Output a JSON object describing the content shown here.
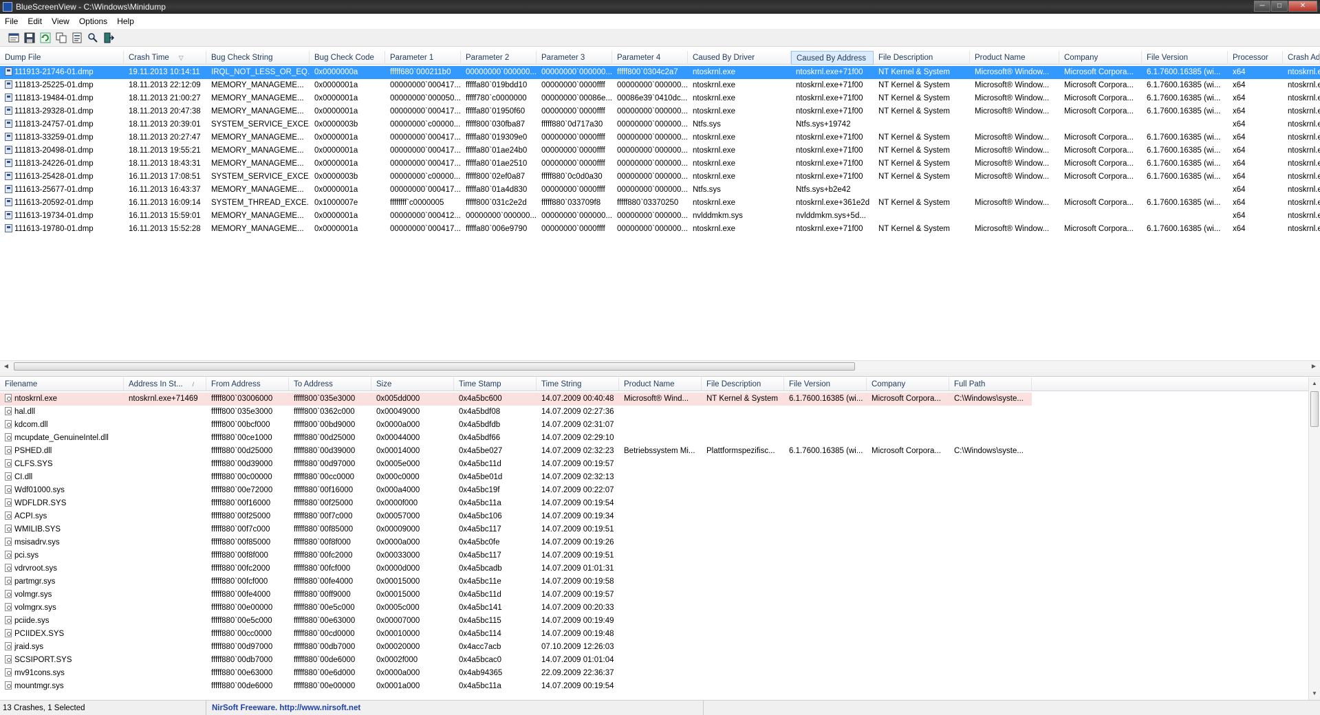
{
  "window": {
    "title": "BlueScreenView  -  C:\\Windows\\Minidump",
    "background_tabs": [
      "",
      "",
      "",
      "",
      ""
    ],
    "controls": [
      "─",
      "□",
      "✕"
    ]
  },
  "menu": [
    "File",
    "Edit",
    "View",
    "Options",
    "Help"
  ],
  "toolbar": [
    "properties-icon",
    "save-icon",
    "refresh-icon",
    "copy-icon",
    "html-report-icon",
    "find-icon",
    "exit-icon"
  ],
  "crashes": {
    "columns": [
      "Dump File",
      "Crash Time",
      "Bug Check String",
      "Bug Check Code",
      "Parameter 1",
      "Parameter 2",
      "Parameter 3",
      "Parameter 4",
      "Caused By Driver",
      "Caused By Address",
      "File Description",
      "Product Name",
      "Company",
      "File Version",
      "Processor",
      "Crash Add"
    ],
    "sort_indicator": "▽",
    "rows": [
      [
        "111913-21746-01.dmp",
        "19.11.2013 10:14:11",
        "IRQL_NOT_LESS_OR_EQ...",
        "0x0000000a",
        "fffff680`000211b0",
        "00000000`000000...",
        "00000000`000000...",
        "fffff800`0304c2a7",
        "ntoskrnl.exe",
        "ntoskrnl.exe+71f00",
        "NT Kernel & System",
        "Microsoft® Window...",
        "Microsoft Corpora...",
        "6.1.7600.16385 (wi...",
        "x64",
        "ntoskrnl.e"
      ],
      [
        "111813-25225-01.dmp",
        "18.11.2013 22:12:09",
        "MEMORY_MANAGEME...",
        "0x0000001a",
        "00000000`000417...",
        "fffffa80`019bdd10",
        "00000000`0000ffff",
        "00000000`000000...",
        "ntoskrnl.exe",
        "ntoskrnl.exe+71f00",
        "NT Kernel & System",
        "Microsoft® Window...",
        "Microsoft Corpora...",
        "6.1.7600.16385 (wi...",
        "x64",
        "ntoskrnl.e"
      ],
      [
        "111813-19484-01.dmp",
        "18.11.2013 21:00:27",
        "MEMORY_MANAGEME...",
        "0x0000001a",
        "00000000`000050...",
        "fffff780`c0000000",
        "00000000`00086e...",
        "00086e39`0410dc...",
        "ntoskrnl.exe",
        "ntoskrnl.exe+71f00",
        "NT Kernel & System",
        "Microsoft® Window...",
        "Microsoft Corpora...",
        "6.1.7600.16385 (wi...",
        "x64",
        "ntoskrnl.e"
      ],
      [
        "111813-29328-01.dmp",
        "18.11.2013 20:47:38",
        "MEMORY_MANAGEME...",
        "0x0000001a",
        "00000000`000417...",
        "fffffa80`01950f60",
        "00000000`0000ffff",
        "00000000`000000...",
        "ntoskrnl.exe",
        "ntoskrnl.exe+71f00",
        "NT Kernel & System",
        "Microsoft® Window...",
        "Microsoft Corpora...",
        "6.1.7600.16385 (wi...",
        "x64",
        "ntoskrnl.e"
      ],
      [
        "111813-24757-01.dmp",
        "18.11.2013 20:39:01",
        "SYSTEM_SERVICE_EXCE...",
        "0x0000003b",
        "00000000`c00000...",
        "fffff800`030fba87",
        "fffff880`0d717a30",
        "00000000`000000...",
        "Ntfs.sys",
        "Ntfs.sys+19742",
        "",
        "",
        "",
        "",
        "x64",
        "ntoskrnl.e"
      ],
      [
        "111813-33259-01.dmp",
        "18.11.2013 20:27:47",
        "MEMORY_MANAGEME...",
        "0x0000001a",
        "00000000`000417...",
        "fffffa80`019309e0",
        "00000000`0000ffff",
        "00000000`000000...",
        "ntoskrnl.exe",
        "ntoskrnl.exe+71f00",
        "NT Kernel & System",
        "Microsoft® Window...",
        "Microsoft Corpora...",
        "6.1.7600.16385 (wi...",
        "x64",
        "ntoskrnl.e"
      ],
      [
        "111813-20498-01.dmp",
        "18.11.2013 19:55:21",
        "MEMORY_MANAGEME...",
        "0x0000001a",
        "00000000`000417...",
        "fffffa80`01ae24b0",
        "00000000`0000ffff",
        "00000000`000000...",
        "ntoskrnl.exe",
        "ntoskrnl.exe+71f00",
        "NT Kernel & System",
        "Microsoft® Window...",
        "Microsoft Corpora...",
        "6.1.7600.16385 (wi...",
        "x64",
        "ntoskrnl.e"
      ],
      [
        "111813-24226-01.dmp",
        "18.11.2013 18:43:31",
        "MEMORY_MANAGEME...",
        "0x0000001a",
        "00000000`000417...",
        "fffffa80`01ae2510",
        "00000000`0000ffff",
        "00000000`000000...",
        "ntoskrnl.exe",
        "ntoskrnl.exe+71f00",
        "NT Kernel & System",
        "Microsoft® Window...",
        "Microsoft Corpora...",
        "6.1.7600.16385 (wi...",
        "x64",
        "ntoskrnl.e"
      ],
      [
        "111613-25428-01.dmp",
        "16.11.2013 17:08:51",
        "SYSTEM_SERVICE_EXCE...",
        "0x0000003b",
        "00000000`c00000...",
        "fffff800`02ef0a87",
        "fffff880`0c0d0a30",
        "00000000`000000...",
        "ntoskrnl.exe",
        "ntoskrnl.exe+71f00",
        "NT Kernel & System",
        "Microsoft® Window...",
        "Microsoft Corpora...",
        "6.1.7600.16385 (wi...",
        "x64",
        "ntoskrnl.e"
      ],
      [
        "111613-25677-01.dmp",
        "16.11.2013 16:43:37",
        "MEMORY_MANAGEME...",
        "0x0000001a",
        "00000000`000417...",
        "fffffa80`01a4d830",
        "00000000`0000ffff",
        "00000000`000000...",
        "Ntfs.sys",
        "Ntfs.sys+b2e42",
        "",
        "",
        "",
        "",
        "x64",
        "ntoskrnl.e"
      ],
      [
        "111613-20592-01.dmp",
        "16.11.2013 16:09:14",
        "SYSTEM_THREAD_EXCE...",
        "0x1000007e",
        "ffffffff`c0000005",
        "fffff800`031c2e2d",
        "fffff880`033709f8",
        "fffff880`03370250",
        "ntoskrnl.exe",
        "ntoskrnl.exe+361e2d",
        "NT Kernel & System",
        "Microsoft® Window...",
        "Microsoft Corpora...",
        "6.1.7600.16385 (wi...",
        "x64",
        "ntoskrnl.e"
      ],
      [
        "111613-19734-01.dmp",
        "16.11.2013 15:59:01",
        "MEMORY_MANAGEME...",
        "0x0000001a",
        "00000000`000412...",
        "00000000`000000...",
        "00000000`000000...",
        "00000000`000000...",
        "nvlddmkm.sys",
        "nvlddmkm.sys+5d...",
        "",
        "",
        "",
        "",
        "x64",
        "ntoskrnl.e"
      ],
      [
        "111613-19780-01.dmp",
        "16.11.2013 15:52:28",
        "MEMORY_MANAGEME...",
        "0x0000001a",
        "00000000`000417...",
        "fffffa80`006e9790",
        "00000000`0000ffff",
        "00000000`000000...",
        "ntoskrnl.exe",
        "ntoskrnl.exe+71f00",
        "NT Kernel & System",
        "Microsoft® Window...",
        "Microsoft Corpora...",
        "6.1.7600.16385 (wi...",
        "x64",
        "ntoskrnl.e"
      ]
    ]
  },
  "drivers": {
    "columns": [
      "Filename",
      "Address In St...",
      "From Address",
      "To Address",
      "Size",
      "Time Stamp",
      "Time String",
      "Product Name",
      "File Description",
      "File Version",
      "Company",
      "Full Path"
    ],
    "sort_indicator": "/",
    "rows": [
      [
        "ntoskrnl.exe",
        "ntoskrnl.exe+71469",
        "fffff800`03006000",
        "fffff800`035e3000",
        "0x005dd000",
        "0x4a5bc600",
        "14.07.2009 00:40:48",
        "Microsoft® Wind...",
        "NT Kernel & System",
        "6.1.7600.16385 (wi...",
        "Microsoft Corpora...",
        "C:\\Windows\\syste..."
      ],
      [
        "hal.dll",
        "",
        "fffff800`035e3000",
        "fffff800`0362c000",
        "0x00049000",
        "0x4a5bdf08",
        "14.07.2009 02:27:36",
        "",
        "",
        "",
        "",
        ""
      ],
      [
        "kdcom.dll",
        "",
        "fffff800`00bcf000",
        "fffff800`00bd9000",
        "0x0000a000",
        "0x4a5bdfdb",
        "14.07.2009 02:31:07",
        "",
        "",
        "",
        "",
        ""
      ],
      [
        "mcupdate_GenuineIntel.dll",
        "",
        "fffff880`00ce1000",
        "fffff880`00d25000",
        "0x00044000",
        "0x4a5bdf66",
        "14.07.2009 02:29:10",
        "",
        "",
        "",
        "",
        ""
      ],
      [
        "PSHED.dll",
        "",
        "fffff880`00d25000",
        "fffff880`00d39000",
        "0x00014000",
        "0x4a5be027",
        "14.07.2009 02:32:23",
        "Betriebssystem Mi...",
        "Plattformspezifisc...",
        "6.1.7600.16385 (wi...",
        "Microsoft Corpora...",
        "C:\\Windows\\syste..."
      ],
      [
        "CLFS.SYS",
        "",
        "fffff880`00d39000",
        "fffff880`00d97000",
        "0x0005e000",
        "0x4a5bc11d",
        "14.07.2009 00:19:57",
        "",
        "",
        "",
        "",
        ""
      ],
      [
        "CI.dll",
        "",
        "fffff880`00c00000",
        "fffff880`00cc0000",
        "0x000c0000",
        "0x4a5be01d",
        "14.07.2009 02:32:13",
        "",
        "",
        "",
        "",
        ""
      ],
      [
        "Wdf01000.sys",
        "",
        "fffff880`00e72000",
        "fffff880`00f16000",
        "0x000a4000",
        "0x4a5bc19f",
        "14.07.2009 00:22:07",
        "",
        "",
        "",
        "",
        ""
      ],
      [
        "WDFLDR.SYS",
        "",
        "fffff880`00f16000",
        "fffff880`00f25000",
        "0x0000f000",
        "0x4a5bc11a",
        "14.07.2009 00:19:54",
        "",
        "",
        "",
        "",
        ""
      ],
      [
        "ACPI.sys",
        "",
        "fffff880`00f25000",
        "fffff880`00f7c000",
        "0x00057000",
        "0x4a5bc106",
        "14.07.2009 00:19:34",
        "",
        "",
        "",
        "",
        ""
      ],
      [
        "WMILIB.SYS",
        "",
        "fffff880`00f7c000",
        "fffff880`00f85000",
        "0x00009000",
        "0x4a5bc117",
        "14.07.2009 00:19:51",
        "",
        "",
        "",
        "",
        ""
      ],
      [
        "msisadrv.sys",
        "",
        "fffff880`00f85000",
        "fffff880`00f8f000",
        "0x0000a000",
        "0x4a5bc0fe",
        "14.07.2009 00:19:26",
        "",
        "",
        "",
        "",
        ""
      ],
      [
        "pci.sys",
        "",
        "fffff880`00f8f000",
        "fffff880`00fc2000",
        "0x00033000",
        "0x4a5bc117",
        "14.07.2009 00:19:51",
        "",
        "",
        "",
        "",
        ""
      ],
      [
        "vdrvroot.sys",
        "",
        "fffff880`00fc2000",
        "fffff880`00fcf000",
        "0x0000d000",
        "0x4a5bcadb",
        "14.07.2009 01:01:31",
        "",
        "",
        "",
        "",
        ""
      ],
      [
        "partmgr.sys",
        "",
        "fffff880`00fcf000",
        "fffff880`00fe4000",
        "0x00015000",
        "0x4a5bc11e",
        "14.07.2009 00:19:58",
        "",
        "",
        "",
        "",
        ""
      ],
      [
        "volmgr.sys",
        "",
        "fffff880`00fe4000",
        "fffff880`00ff9000",
        "0x00015000",
        "0x4a5bc11d",
        "14.07.2009 00:19:57",
        "",
        "",
        "",
        "",
        ""
      ],
      [
        "volmgrx.sys",
        "",
        "fffff880`00e00000",
        "fffff880`00e5c000",
        "0x0005c000",
        "0x4a5bc141",
        "14.07.2009 00:20:33",
        "",
        "",
        "",
        "",
        ""
      ],
      [
        "pciide.sys",
        "",
        "fffff880`00e5c000",
        "fffff880`00e63000",
        "0x00007000",
        "0x4a5bc115",
        "14.07.2009 00:19:49",
        "",
        "",
        "",
        "",
        ""
      ],
      [
        "PCIIDEX.SYS",
        "",
        "fffff880`00cc0000",
        "fffff880`00cd0000",
        "0x00010000",
        "0x4a5bc114",
        "14.07.2009 00:19:48",
        "",
        "",
        "",
        "",
        ""
      ],
      [
        "jraid.sys",
        "",
        "fffff880`00d97000",
        "fffff880`00db7000",
        "0x00020000",
        "0x4acc7acb",
        "07.10.2009 12:26:03",
        "",
        "",
        "",
        "",
        ""
      ],
      [
        "SCSIPORT.SYS",
        "",
        "fffff880`00db7000",
        "fffff880`00de6000",
        "0x0002f000",
        "0x4a5bcac0",
        "14.07.2009 01:01:04",
        "",
        "",
        "",
        "",
        ""
      ],
      [
        "mv91cons.sys",
        "",
        "fffff880`00e63000",
        "fffff880`00e6d000",
        "0x0000a000",
        "0x4ab94365",
        "22.09.2009 22:36:37",
        "",
        "",
        "",
        "",
        ""
      ],
      [
        "mountmgr.sys",
        "",
        "fffff880`00de6000",
        "fffff880`00e00000",
        "0x0001a000",
        "0x4a5bc11a",
        "14.07.2009 00:19:54",
        "",
        "",
        "",
        "",
        ""
      ]
    ]
  },
  "status": {
    "summary": "13 Crashes, 1 Selected",
    "freeware": "NirSoft Freeware.  http://www.nirsoft.net"
  }
}
